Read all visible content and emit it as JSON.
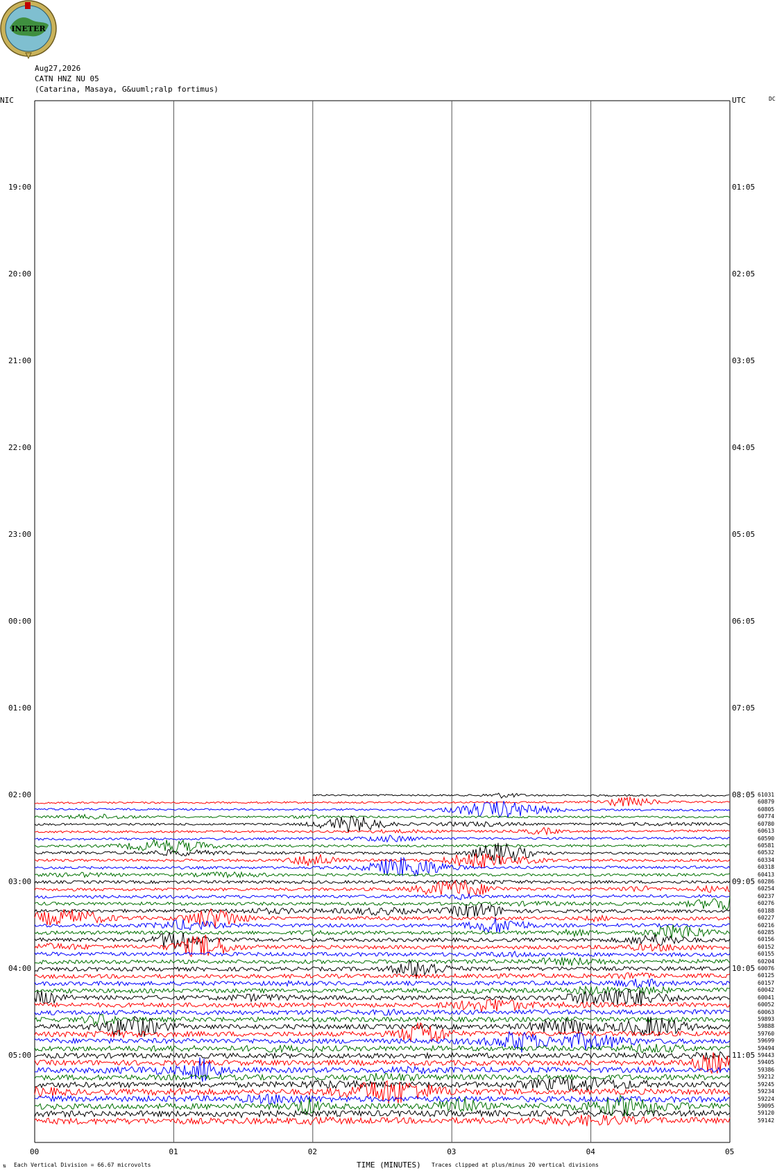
{
  "logo": {
    "text": "INETER",
    "colors": {
      "ring": "#c9b25a",
      "disk": "#7fbfd0",
      "land": "#3f8f3f",
      "star": "#c00000"
    }
  },
  "header": {
    "date": "Aug27,2026",
    "station": "CATN HNZ NU 05",
    "location": "(Catarina, Masaya, G&uuml;ralp fortimus)"
  },
  "corner_labels": {
    "left": "NIC",
    "right": "UTC",
    "dc": "DC"
  },
  "footer": {
    "vertical_division": "Each Vertical Division =    66.67 microvolts",
    "xlabel": "TIME (MINUTES)",
    "clip_note": "Traces clipped at plus/minus 20 vertical divisions"
  },
  "chart_data": {
    "type": "line",
    "title": "",
    "xlabel": "TIME (MINUTES)",
    "x_ticks": [
      "00",
      "01",
      "02",
      "03",
      "04",
      "05"
    ],
    "xlim": [
      0,
      5
    ],
    "vertical_grid_minutes": [
      1,
      2,
      3,
      4
    ],
    "left_time_labels": [
      "19:00",
      "20:00",
      "21:00",
      "22:00",
      "23:00",
      "00:00",
      "01:00",
      "02:00",
      "03:00",
      "04:00",
      "05:00"
    ],
    "right_time_labels": [
      "01:05",
      "02:05",
      "03:05",
      "04:05",
      "05:05",
      "06:05",
      "07:05",
      "08:05",
      "09:05",
      "10:05",
      "11:05"
    ],
    "hours_span": 12,
    "trace_colors": [
      "#000000",
      "#ff0000",
      "#0000ff",
      "#007000"
    ],
    "first_trace_start_minute": 2,
    "trace_dc_values": [
      "61031",
      "60879",
      "60805",
      "60774",
      "60780",
      "60613",
      "60590",
      "60581",
      "60532",
      "60334",
      "60318",
      "60413",
      "60286",
      "60254",
      "60237",
      "60276",
      "60188",
      "60227",
      "60216",
      "60285",
      "60156",
      "60152",
      "60155",
      "60204",
      "60076",
      "60125",
      "60157",
      "60042",
      "60041",
      "60052",
      "60063",
      "59893",
      "59888",
      "59760",
      "59699",
      "59494",
      "59443",
      "59405",
      "59386",
      "59212",
      "59245",
      "59234",
      "59224",
      "59095",
      "59120",
      "59142"
    ]
  }
}
